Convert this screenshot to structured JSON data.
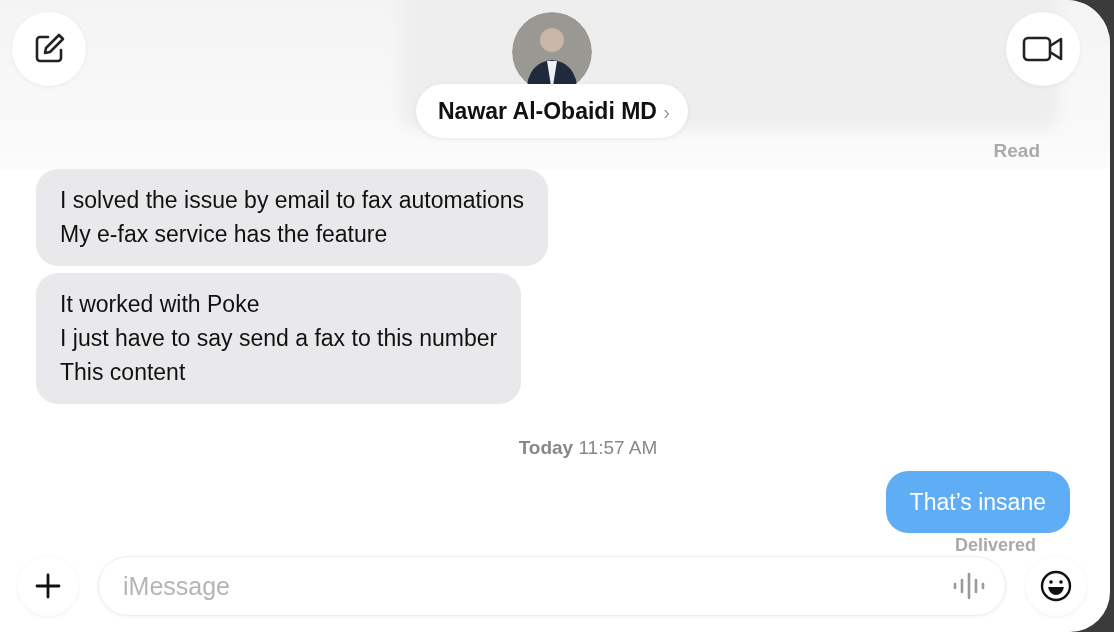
{
  "header": {
    "contact_name": "Nawar Al-Obaidi MD",
    "chevron": "›"
  },
  "earlier_status": "Read",
  "messages": [
    {
      "kind": "received",
      "lines": [
        "I solved the issue by email to fax automations",
        "My e-fax service has the feature"
      ]
    },
    {
      "kind": "received",
      "lines": [
        "It worked with Poke",
        "I just have to say send a fax to this number",
        "This content"
      ]
    },
    {
      "kind": "timestamp",
      "day": "Today",
      "time": "11:57 AM"
    },
    {
      "kind": "sent",
      "lines": [
        "That’s insane"
      ]
    }
  ],
  "sent_status": "Delivered",
  "composer": {
    "placeholder": "iMessage"
  }
}
